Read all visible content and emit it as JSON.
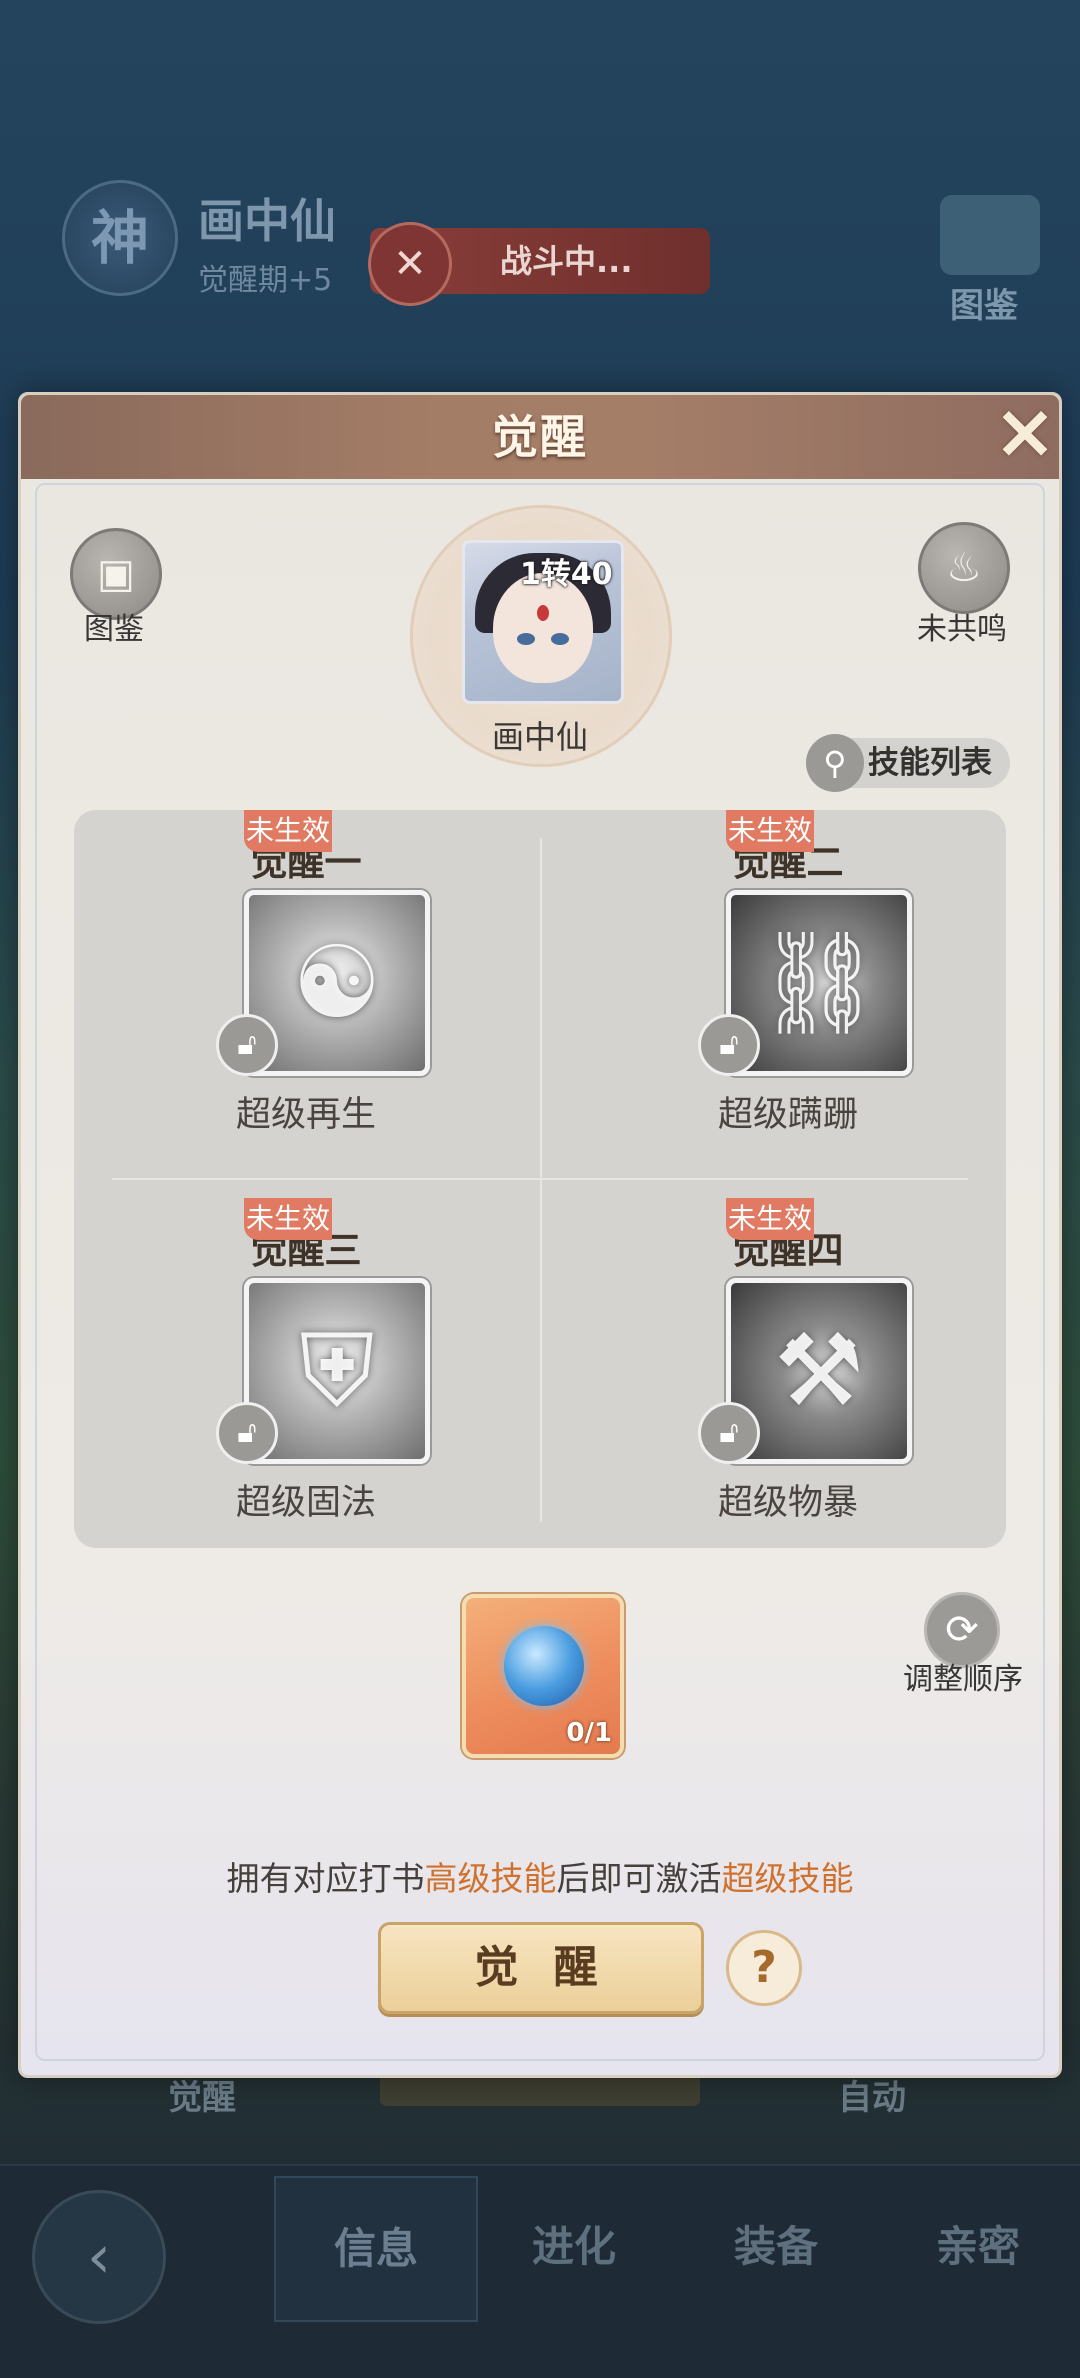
{
  "background": {
    "hero_badge": "神",
    "hero_name": "画中仙",
    "hero_stage": "觉醒期+5",
    "battle_status": "战斗中...",
    "tujian_label": "图鉴",
    "behind_left": "觉醒",
    "behind_right": "自动",
    "tabs": [
      {
        "label": "信息",
        "active": true
      },
      {
        "label": "进化",
        "active": false
      },
      {
        "label": "装备",
        "active": false
      },
      {
        "label": "亲密",
        "active": false
      }
    ]
  },
  "modal": {
    "title": "觉醒",
    "left_icon_label": "图鉴",
    "right_icon_label": "未共鸣",
    "hero": {
      "level": "1转40",
      "name": "画中仙"
    },
    "skill_list_label": "技能列表",
    "slots": [
      {
        "title": "觉醒一",
        "badge": "未生效",
        "skill": "超级再生",
        "icon": "meditating-demon-icon"
      },
      {
        "title": "觉醒二",
        "badge": "未生效",
        "skill": "超级蹒跚",
        "icon": "chained-boot-icon"
      },
      {
        "title": "觉醒三",
        "badge": "未生效",
        "skill": "超级固法",
        "icon": "flame-shield-icon"
      },
      {
        "title": "觉醒四",
        "badge": "未生效",
        "skill": "超级物暴",
        "icon": "axe-icon"
      }
    ],
    "item": {
      "count": "0/1"
    },
    "reorder_label": "调整顺序",
    "hint": {
      "part1": "拥有对应打书",
      "hl1": "高级技能",
      "part2": "后即可激活",
      "hl2": "超级技能"
    },
    "awaken_button": "觉 醒",
    "help_symbol": "?"
  },
  "colors": {
    "accent_orange": "#d0722f",
    "badge_red": "#e07a62",
    "header_brown": "#a47d66"
  }
}
